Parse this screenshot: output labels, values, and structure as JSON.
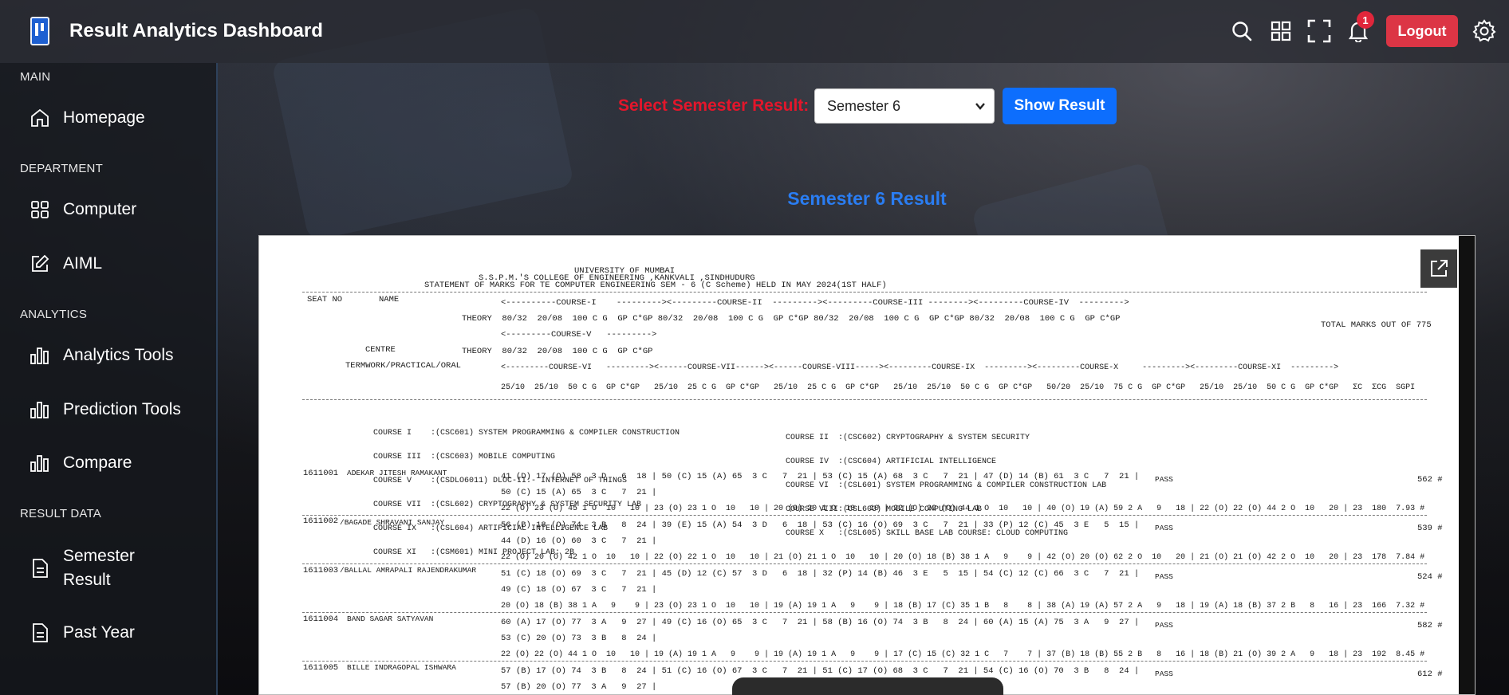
{
  "header": {
    "title": "Result Analytics Dashboard",
    "notification_count": "1",
    "logout_label": "Logout",
    "icons": [
      "search-icon",
      "grid-icon",
      "fullscreen-icon",
      "bell-icon",
      "gear-icon"
    ]
  },
  "sidebar": {
    "sections": {
      "main": "MAIN",
      "department": "DEPARTMENT",
      "analytics": "ANALYTICS",
      "result_data": "RESULT DATA"
    },
    "items": {
      "homepage": "Homepage",
      "computer": "Computer",
      "aiml": "AIML",
      "analytics_tools": "Analytics Tools",
      "prediction_tools": "Prediction Tools",
      "compare": "Compare",
      "semester_result_1": "Semester",
      "semester_result_2": "Result",
      "past_year": "Past Year"
    }
  },
  "main": {
    "select_label": "Select Semester Result:",
    "selected_semester": "Semester 6",
    "show_button": "Show Result",
    "result_title": "Semester 6 Result"
  },
  "colors": {
    "accent_blue": "#0d6efd",
    "title_blue": "#2a7df2",
    "label_red": "#e3162b",
    "logout_red": "#dc3545"
  },
  "document": {
    "h1": "UNIVERSITY OF MUMBAI",
    "h2": "S.S.P.M.'S COLLEGE OF ENGINEERING ,KANKVALI ,SINDHUDURG",
    "h3": "STATEMENT OF MARKS FOR TE COMPUTER ENGINEERING SEM - 6 (C Scheme) HELD IN MAY 2024(1ST HALF)",
    "seat_no": "SEAT NO",
    "name": "NAME",
    "course_row1": "<----------COURSE-I    ---------><---------COURSE-II  ---------><---------COURSE-III --------><---------COURSE-IV  --------->",
    "theory_row1": "THEORY  80/32  20/08  100 C G  GP C*GP 80/32  20/08  100 C G  GP C*GP 80/32  20/08  100 C G  GP C*GP 80/32  20/08  100 C G  GP C*GP",
    "total_marks": "TOTAL MARKS OUT OF 775",
    "course_row2": "<---------COURSE-V   --------->",
    "centre": "CENTRE",
    "theory_row2": "THEORY  80/32  20/08  100 C G  GP C*GP",
    "termwork": "TERMWORK/PRACTICAL/ORAL",
    "course_row3": "<---------COURSE-VI   ---------><------COURSE-VII------><------COURSE-VIII-----><---------COURSE-IX  ---------><---------COURSE-X     ---------><---------COURSE-XI  --------->",
    "tw_row": "25/10  25/10  50 C G  GP C*GP   25/10  25 C G  GP C*GP   25/10  25 C G  GP C*GP   25/10  25/10  50 C G  GP C*GP   50/20  25/10  75 C G  GP C*GP   25/10  25/10  50 C G  GP C*GP   ΣC  ΣCG  SGPI",
    "courses_left": [
      "COURSE I    :(CSC601) SYSTEM PROGRAMMING & COMPILER CONSTRUCTION",
      "COURSE III  :(CSC603) MOBILE COMPUTING",
      "COURSE V    :(CSDLO6011) DLOC-II:- INTERNET OF THINGS",
      "COURSE VII  :(CSL602) CRYPTOGRAPHY & SYSTEM SECURITY LAB",
      "COURSE IX   :(CSL604) ARTIFICIAL INTELLIGENCE LAB",
      "COURSE XI   :(CSM601) MINI PROJECT LAB: 2B"
    ],
    "courses_right": [
      "COURSE II  :(CSC602) CRYPTOGRAPHY & SYSTEM SECURITY",
      "COURSE IV  :(CSC604) ARTIFICIAL INTELLIGENCE",
      "COURSE VI  :(CSL601) SYSTEM PROGRAMMING & COMPILER CONSTRUCTION LAB",
      "COURSE VIII:(CSL603) MOBILE COMPUTING LAB",
      "COURSE X   :(CSL605) SKILL BASE LAB COURSE: CLOUD COMPUTING"
    ],
    "students": [
      {
        "seat": "1611001",
        "name": "ADEKAR JITESH RAMAKANT",
        "l1": "41 (D) 17 (O) 58  3 D   6  18 | 50 (C) 15 (A) 65  3 C   7  21 | 53 (C) 15 (A) 68  3 C   7  21 | 47 (D) 14 (B) 61  3 C   7  21 |",
        "l2": "50 (C) 15 (A) 65  3 C   7  21 |",
        "l3": "22 (O) 23 (O) 45 1 O  10   10 | 23 (O) 23 1 O  10   10 | 20 (O) 20 1 O  10   10 | 22 (O) 22 (O) 44 1 O  10   10 | 40 (O) 19 (A) 59 2 A   9   18 | 22 (O) 22 (O) 44 2 O  10   20 | 23  180  7.93 #",
        "status": "PASS",
        "marks": "562 #"
      },
      {
        "seat": "1611002",
        "name": "/BAGADE SHRAVANI SANJAY",
        "l1": "56 (B) 18 (O) 74  3 B   8  24 | 39 (E) 15 (A) 54  3 D   6  18 | 53 (C) 16 (O) 69  3 C   7  21 | 33 (P) 12 (C) 45  3 E   5  15 |",
        "l2": "44 (D) 16 (O) 60  3 C   7  21 |",
        "l3": "22 (O) 20 (O) 42 1 O  10   10 | 22 (O) 22 1 O  10   10 | 21 (O) 21 1 O  10   10 | 20 (O) 18 (B) 38 1 A   9    9 | 42 (O) 20 (O) 62 2 O  10   20 | 21 (O) 21 (O) 42 2 O  10   20 | 23  178  7.84 #",
        "status": "PASS",
        "marks": "539 #"
      },
      {
        "seat": "1611003",
        "name": "/BALLAL AMRAPALI RAJENDRAKUMAR",
        "l1": "51 (C) 18 (O) 69  3 C   7  21 | 45 (D) 12 (C) 57  3 D   6  18 | 32 (P) 14 (B) 46  3 E   5  15 | 54 (C) 12 (C) 66  3 C   7  21 |",
        "l2": "49 (C) 18 (O) 67  3 C   7  21 |",
        "l3": "20 (O) 18 (B) 38 1 A   9    9 | 23 (O) 23 1 O  10   10 | 19 (A) 19 1 A   9    9 | 18 (B) 17 (C) 35 1 B   8    8 | 38 (A) 19 (A) 57 2 A   9   18 | 19 (A) 18 (B) 37 2 B   8   16 | 23  166  7.32 #",
        "status": "PASS",
        "marks": "524 #"
      },
      {
        "seat": "1611004",
        "name": "BAND SAGAR SATYAVAN",
        "l1": "60 (A) 17 (O) 77  3 A   9  27 | 49 (C) 16 (O) 65  3 C   7  21 | 58 (B) 16 (O) 74  3 B   8  24 | 60 (A) 15 (A) 75  3 A   9  27 |",
        "l2": "53 (C) 20 (O) 73  3 B   8  24 |",
        "l3": "22 (O) 22 (O) 44 1 O  10   10 | 19 (A) 19 1 A   9    9 | 19 (A) 19 1 A   9    9 | 17 (C) 15 (C) 32 1 C   7    7 | 37 (B) 18 (B) 55 2 B   8   16 | 18 (B) 21 (O) 39 2 A   9   18 | 23  192  8.45 #",
        "status": "PASS",
        "marks": "582 #"
      },
      {
        "seat": "1611005",
        "name": "BILLE INDRAGOPAL ISHWARA",
        "l1": "57 (B) 17 (O) 74  3 B   8  24 | 51 (C) 16 (O) 67  3 C   7  21 | 51 (C) 17 (O) 68  3 C   7  21 | 54 (C) 16 (O) 70  3 B   8  24 |",
        "l2": "57 (B) 20 (O) 77  3 A   9  27 |",
        "status": "PASS",
        "marks": "612 #"
      }
    ]
  }
}
